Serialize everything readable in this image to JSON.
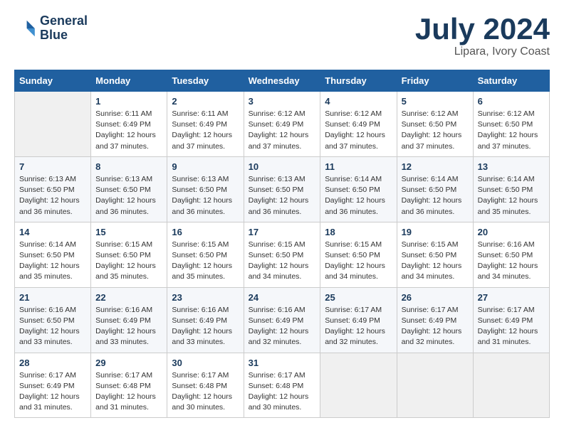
{
  "header": {
    "logo_line1": "General",
    "logo_line2": "Blue",
    "title": "July 2024",
    "subtitle": "Lipara, Ivory Coast"
  },
  "calendar": {
    "days_of_week": [
      "Sunday",
      "Monday",
      "Tuesday",
      "Wednesday",
      "Thursday",
      "Friday",
      "Saturday"
    ],
    "weeks": [
      [
        {
          "day": "",
          "info": ""
        },
        {
          "day": "1",
          "info": "Sunrise: 6:11 AM\nSunset: 6:49 PM\nDaylight: 12 hours\nand 37 minutes."
        },
        {
          "day": "2",
          "info": "Sunrise: 6:11 AM\nSunset: 6:49 PM\nDaylight: 12 hours\nand 37 minutes."
        },
        {
          "day": "3",
          "info": "Sunrise: 6:12 AM\nSunset: 6:49 PM\nDaylight: 12 hours\nand 37 minutes."
        },
        {
          "day": "4",
          "info": "Sunrise: 6:12 AM\nSunset: 6:49 PM\nDaylight: 12 hours\nand 37 minutes."
        },
        {
          "day": "5",
          "info": "Sunrise: 6:12 AM\nSunset: 6:50 PM\nDaylight: 12 hours\nand 37 minutes."
        },
        {
          "day": "6",
          "info": "Sunrise: 6:12 AM\nSunset: 6:50 PM\nDaylight: 12 hours\nand 37 minutes."
        }
      ],
      [
        {
          "day": "7",
          "info": "Sunrise: 6:13 AM\nSunset: 6:50 PM\nDaylight: 12 hours\nand 36 minutes."
        },
        {
          "day": "8",
          "info": "Sunrise: 6:13 AM\nSunset: 6:50 PM\nDaylight: 12 hours\nand 36 minutes."
        },
        {
          "day": "9",
          "info": "Sunrise: 6:13 AM\nSunset: 6:50 PM\nDaylight: 12 hours\nand 36 minutes."
        },
        {
          "day": "10",
          "info": "Sunrise: 6:13 AM\nSunset: 6:50 PM\nDaylight: 12 hours\nand 36 minutes."
        },
        {
          "day": "11",
          "info": "Sunrise: 6:14 AM\nSunset: 6:50 PM\nDaylight: 12 hours\nand 36 minutes."
        },
        {
          "day": "12",
          "info": "Sunrise: 6:14 AM\nSunset: 6:50 PM\nDaylight: 12 hours\nand 36 minutes."
        },
        {
          "day": "13",
          "info": "Sunrise: 6:14 AM\nSunset: 6:50 PM\nDaylight: 12 hours\nand 35 minutes."
        }
      ],
      [
        {
          "day": "14",
          "info": "Sunrise: 6:14 AM\nSunset: 6:50 PM\nDaylight: 12 hours\nand 35 minutes."
        },
        {
          "day": "15",
          "info": "Sunrise: 6:15 AM\nSunset: 6:50 PM\nDaylight: 12 hours\nand 35 minutes."
        },
        {
          "day": "16",
          "info": "Sunrise: 6:15 AM\nSunset: 6:50 PM\nDaylight: 12 hours\nand 35 minutes."
        },
        {
          "day": "17",
          "info": "Sunrise: 6:15 AM\nSunset: 6:50 PM\nDaylight: 12 hours\nand 34 minutes."
        },
        {
          "day": "18",
          "info": "Sunrise: 6:15 AM\nSunset: 6:50 PM\nDaylight: 12 hours\nand 34 minutes."
        },
        {
          "day": "19",
          "info": "Sunrise: 6:15 AM\nSunset: 6:50 PM\nDaylight: 12 hours\nand 34 minutes."
        },
        {
          "day": "20",
          "info": "Sunrise: 6:16 AM\nSunset: 6:50 PM\nDaylight: 12 hours\nand 34 minutes."
        }
      ],
      [
        {
          "day": "21",
          "info": "Sunrise: 6:16 AM\nSunset: 6:50 PM\nDaylight: 12 hours\nand 33 minutes."
        },
        {
          "day": "22",
          "info": "Sunrise: 6:16 AM\nSunset: 6:49 PM\nDaylight: 12 hours\nand 33 minutes."
        },
        {
          "day": "23",
          "info": "Sunrise: 6:16 AM\nSunset: 6:49 PM\nDaylight: 12 hours\nand 33 minutes."
        },
        {
          "day": "24",
          "info": "Sunrise: 6:16 AM\nSunset: 6:49 PM\nDaylight: 12 hours\nand 32 minutes."
        },
        {
          "day": "25",
          "info": "Sunrise: 6:17 AM\nSunset: 6:49 PM\nDaylight: 12 hours\nand 32 minutes."
        },
        {
          "day": "26",
          "info": "Sunrise: 6:17 AM\nSunset: 6:49 PM\nDaylight: 12 hours\nand 32 minutes."
        },
        {
          "day": "27",
          "info": "Sunrise: 6:17 AM\nSunset: 6:49 PM\nDaylight: 12 hours\nand 31 minutes."
        }
      ],
      [
        {
          "day": "28",
          "info": "Sunrise: 6:17 AM\nSunset: 6:49 PM\nDaylight: 12 hours\nand 31 minutes."
        },
        {
          "day": "29",
          "info": "Sunrise: 6:17 AM\nSunset: 6:48 PM\nDaylight: 12 hours\nand 31 minutes."
        },
        {
          "day": "30",
          "info": "Sunrise: 6:17 AM\nSunset: 6:48 PM\nDaylight: 12 hours\nand 30 minutes."
        },
        {
          "day": "31",
          "info": "Sunrise: 6:17 AM\nSunset: 6:48 PM\nDaylight: 12 hours\nand 30 minutes."
        },
        {
          "day": "",
          "info": ""
        },
        {
          "day": "",
          "info": ""
        },
        {
          "day": "",
          "info": ""
        }
      ]
    ]
  }
}
